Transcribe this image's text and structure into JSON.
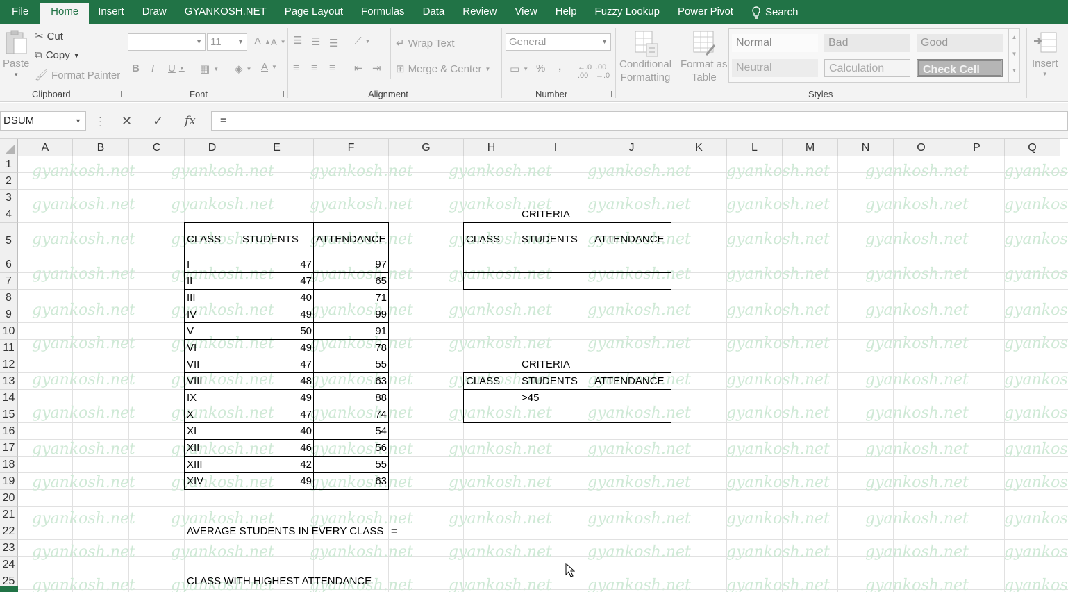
{
  "menu": {
    "tabs": [
      "File",
      "Home",
      "Insert",
      "Draw",
      "GYANKOSH.NET",
      "Page Layout",
      "Formulas",
      "Data",
      "Review",
      "View",
      "Help",
      "Fuzzy Lookup",
      "Power Pivot"
    ],
    "search": "Search"
  },
  "ribbon": {
    "clipboard": {
      "paste": "Paste",
      "cut": "Cut",
      "copy": "Copy",
      "format_painter": "Format Painter",
      "label": "Clipboard"
    },
    "font": {
      "size": "11",
      "bold": "B",
      "italic": "I",
      "underline": "U",
      "label": "Font"
    },
    "alignment": {
      "wrap_text": "Wrap Text",
      "merge_center": "Merge & Center",
      "label": "Alignment"
    },
    "number": {
      "format": "General",
      "percent": "%",
      "comma": ",",
      "label": "Number"
    },
    "styles": {
      "conditional_formatting": [
        "Conditional",
        "Formatting"
      ],
      "format_as_table": [
        "Format as",
        "Table"
      ],
      "normal": "Normal",
      "bad": "Bad",
      "good": "Good",
      "neutral": "Neutral",
      "calculation": "Calculation",
      "check_cell": "Check Cell",
      "label": "Styles"
    },
    "cells": {
      "insert": "Insert"
    }
  },
  "formula_bar": {
    "name_box": "DSUM",
    "formula": "="
  },
  "columns": [
    "A",
    "B",
    "C",
    "D",
    "E",
    "F",
    "G",
    "H",
    "I",
    "J",
    "K",
    "L",
    "M",
    "N",
    "O",
    "P",
    "Q"
  ],
  "rows": [
    "1",
    "2",
    "3",
    "4",
    "5",
    "6",
    "7",
    "8",
    "9",
    "10",
    "11",
    "12",
    "13",
    "14",
    "15",
    "16",
    "17",
    "18",
    "19",
    "20",
    "21",
    "22",
    "23",
    "24",
    "25"
  ],
  "watermark": "gyankosh.net",
  "main_table": {
    "headers": [
      "CLASS",
      "STUDENTS",
      "ATTENDANCE"
    ],
    "rows": [
      [
        "I",
        "47",
        "97"
      ],
      [
        "II",
        "47",
        "65"
      ],
      [
        "III",
        "40",
        "71"
      ],
      [
        "IV",
        "49",
        "99"
      ],
      [
        "V",
        "50",
        "91"
      ],
      [
        "VI",
        "49",
        "78"
      ],
      [
        "VII",
        "47",
        "55"
      ],
      [
        "VIII",
        "48",
        "63"
      ],
      [
        "IX",
        "49",
        "88"
      ],
      [
        "X",
        "47",
        "74"
      ],
      [
        "XI",
        "40",
        "54"
      ],
      [
        "XII",
        "46",
        "56"
      ],
      [
        "XIII",
        "42",
        "55"
      ],
      [
        "XIV",
        "49",
        "63"
      ]
    ]
  },
  "criteria1": {
    "title": "CRITERIA",
    "headers": [
      "CLASS",
      "STUDENTS",
      "ATTENDANCE"
    ]
  },
  "criteria2": {
    "title": "CRITERIA",
    "headers": [
      "CLASS",
      "STUDENTS",
      "ATTENDANCE"
    ],
    "value": ">45"
  },
  "questions": {
    "q1": "AVERAGE STUDENTS IN EVERY CLASS",
    "q1_eq": "=",
    "q2": "CLASS WITH HIGHEST ATTENDANCE"
  }
}
